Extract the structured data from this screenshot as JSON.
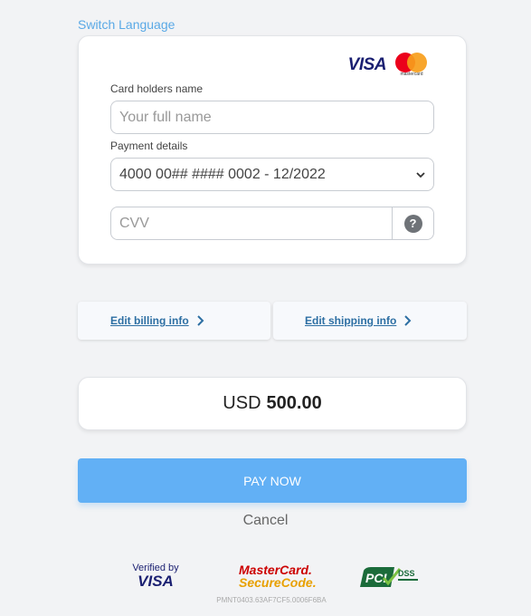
{
  "header": {
    "switch_language": "Switch Language"
  },
  "card_form": {
    "brands": {
      "visa": "VISA",
      "mastercard": "mastercard"
    },
    "name_label": "Card holders name",
    "name_placeholder": "Your full name",
    "payment_label": "Payment details",
    "payment_selected": "4000 00## #### 0002 - 12/2022",
    "cvv_placeholder": "CVV",
    "help_glyph": "?"
  },
  "links": {
    "billing": "Edit billing info",
    "shipping": "Edit shipping info"
  },
  "amount": {
    "currency": "USD",
    "value": "500.00"
  },
  "actions": {
    "pay": "PAY NOW",
    "cancel": "Cancel"
  },
  "badges": {
    "verified_by": "Verified by",
    "verified_visa": "VISA",
    "mc_line1": "MasterCard.",
    "mc_line2": "SecureCode.",
    "pci": "PCI",
    "dss": "DSS"
  },
  "reference": "PMNT0403.63AF7CF5.0006F6BA",
  "colors": {
    "accent": "#62b0f5",
    "link": "#2d6fa3",
    "switch_link": "#5aa9e6",
    "background": "#f2f3f5"
  },
  "icons": [
    "help-icon",
    "chevron-down-icon",
    "chevron-right-icon"
  ]
}
